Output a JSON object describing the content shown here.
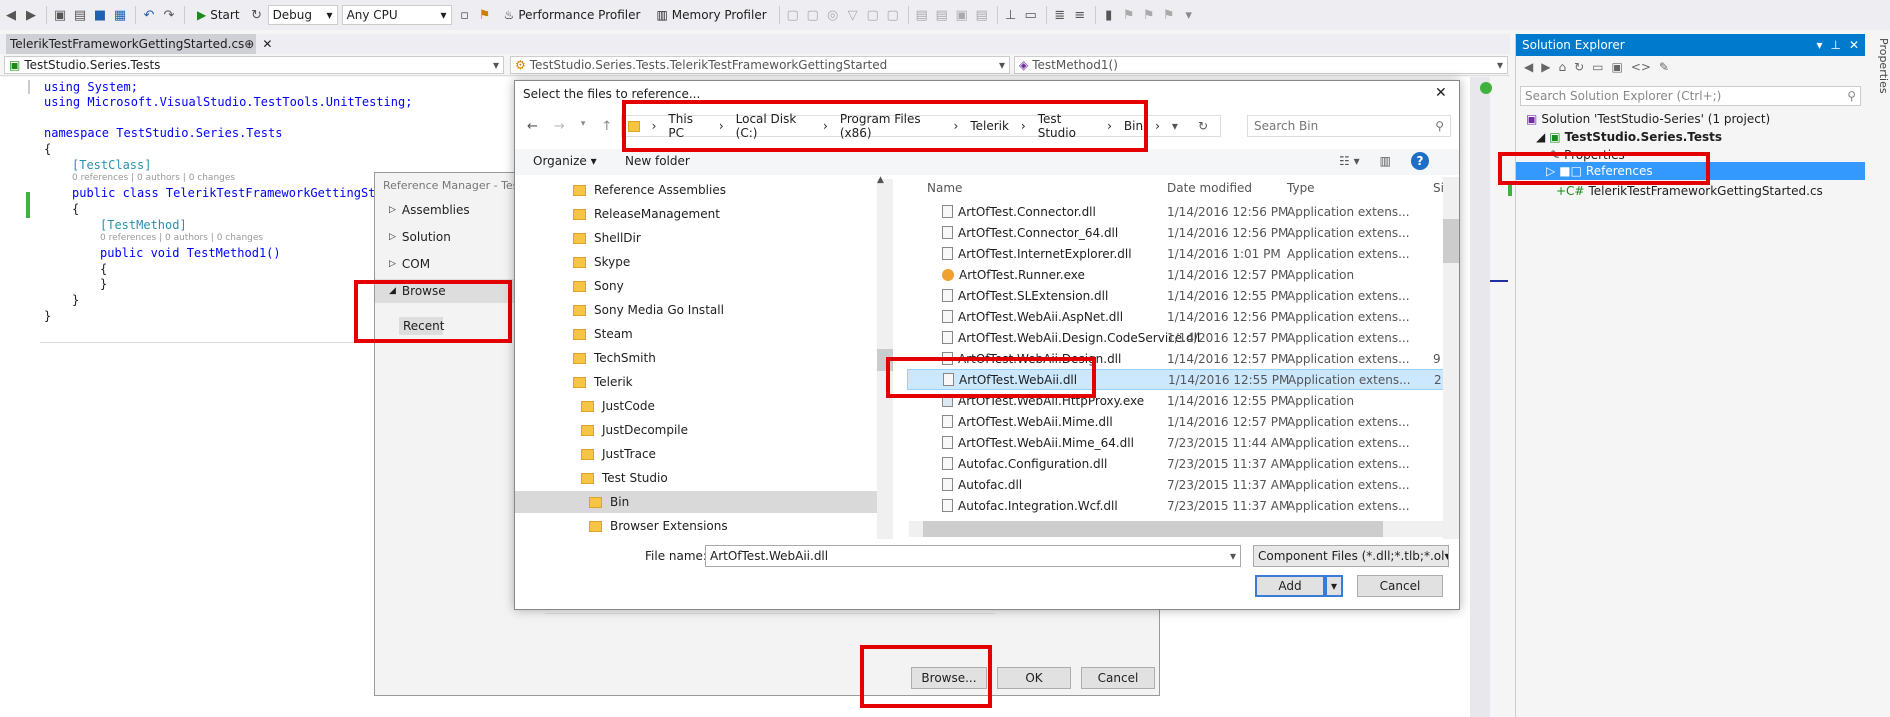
{
  "toolbar": {
    "config": "Debug",
    "platform": "Any CPU",
    "start_label": "Start",
    "perf_profiler": "Performance Profiler",
    "mem_profiler": "Memory Profiler"
  },
  "tab": {
    "name": "TelerikTestFrameworkGettingStarted.cs",
    "pin": "⊕",
    "close": "✕"
  },
  "nav": {
    "project": "TestStudio.Series.Tests",
    "class": "TestStudio.Series.Tests.TelerikTestFrameworkGettingStarted",
    "member": "TestMethod1()"
  },
  "code": {
    "l1": "using System;",
    "l2": "using Microsoft.VisualStudio.TestTools.UnitTesting;",
    "l3": "namespace TestStudio.Series.Tests",
    "l4": "{",
    "attr1": "[TestClass]",
    "lens1": "0 references | 0 authors | 0 changes",
    "l6": "public class TelerikTestFrameworkGettingSta",
    "l7": "{",
    "attr2": "[TestMethod]",
    "lens2": "0 references | 0 authors | 0 changes",
    "l9": "public void TestMethod1()",
    "l10": "{",
    "l11": "}",
    "l12": "}",
    "l13": "}"
  },
  "solution_explorer": {
    "title": "Solution Explorer",
    "search_placeholder": "Search Solution Explorer (Ctrl+;)",
    "solution": "Solution 'TestStudio-Series' (1 project)",
    "project": "TestStudio.Series.Tests",
    "properties": "Properties",
    "references": "References",
    "file": "TelerikTestFrameworkGettingStarted.cs",
    "side_tab": "Properties"
  },
  "ref_manager": {
    "title": "Reference Manager - Test",
    "nav": [
      "Assemblies",
      "Solution",
      "COM",
      "Browse"
    ],
    "recent": "Recent",
    "browse_btn": "Browse...",
    "ok": "OK",
    "cancel": "Cancel"
  },
  "dialog": {
    "title": "Select the files to reference...",
    "close": "✕",
    "crumbs": [
      "This PC",
      "Local Disk (C:)",
      "Program Files (x86)",
      "Telerik",
      "Test Studio",
      "Bin"
    ],
    "search_placeholder": "Search Bin",
    "organize": "Organize ▾",
    "new_folder": "New folder",
    "folders": [
      "Reference Assemblies",
      "ReleaseManagement",
      "ShellDir",
      "Skype",
      "Sony",
      "Sony Media Go Install",
      "Steam",
      "TechSmith",
      "Telerik",
      "JustCode",
      "JustDecompile",
      "JustTrace",
      "Test Studio",
      "Bin",
      "Browser Extensions"
    ],
    "columns": {
      "name": "Name",
      "date": "Date modified",
      "type": "Type",
      "size": "Size"
    },
    "files": [
      {
        "name": "ArtOfTest.Connector.dll",
        "date": "1/14/2016 12:56 PM",
        "type": "Application extens...",
        "size": ""
      },
      {
        "name": "ArtOfTest.Connector_64.dll",
        "date": "1/14/2016 12:56 PM",
        "type": "Application extens...",
        "size": ""
      },
      {
        "name": "ArtOfTest.InternetExplorer.dll",
        "date": "1/14/2016 1:01 PM",
        "type": "Application extens...",
        "size": ""
      },
      {
        "name": "ArtOfTest.Runner.exe",
        "date": "1/14/2016 12:57 PM",
        "type": "Application",
        "size": ""
      },
      {
        "name": "ArtOfTest.SLExtension.dll",
        "date": "1/14/2016 12:55 PM",
        "type": "Application extens...",
        "size": ""
      },
      {
        "name": "ArtOfTest.WebAii.AspNet.dll",
        "date": "1/14/2016 12:56 PM",
        "type": "Application extens...",
        "size": ""
      },
      {
        "name": "ArtOfTest.WebAii.Design.CodeService.dll",
        "date": "1/14/2016 12:57 PM",
        "type": "Application extens...",
        "size": ""
      },
      {
        "name": "ArtOfTest.WebAii.Design.dll",
        "date": "1/14/2016 12:57 PM",
        "type": "Application extens...",
        "size": "9"
      },
      {
        "name": "ArtOfTest.WebAii.dll",
        "date": "1/14/2016 12:55 PM",
        "type": "Application extens...",
        "size": "2"
      },
      {
        "name": "ArtOfTest.WebAii.HttpProxy.exe",
        "date": "1/14/2016 12:55 PM",
        "type": "Application",
        "size": ""
      },
      {
        "name": "ArtOfTest.WebAii.Mime.dll",
        "date": "1/14/2016 12:57 PM",
        "type": "Application extens...",
        "size": ""
      },
      {
        "name": "ArtOfTest.WebAii.Mime_64.dll",
        "date": "7/23/2015 11:44 AM",
        "type": "Application extens...",
        "size": ""
      },
      {
        "name": "Autofac.Configuration.dll",
        "date": "7/23/2015 11:37 AM",
        "type": "Application extens...",
        "size": ""
      },
      {
        "name": "Autofac.dll",
        "date": "7/23/2015 11:37 AM",
        "type": "Application extens...",
        "size": ""
      },
      {
        "name": "Autofac.Integration.Wcf.dll",
        "date": "7/23/2015 11:37 AM",
        "type": "Application extens...",
        "size": ""
      }
    ],
    "filename_label": "File name:",
    "filename_value": "ArtOfTest.WebAii.dll",
    "filter": "Component Files (*.dll;*.tlb;*.ol",
    "add": "Add",
    "cancel": "Cancel"
  }
}
